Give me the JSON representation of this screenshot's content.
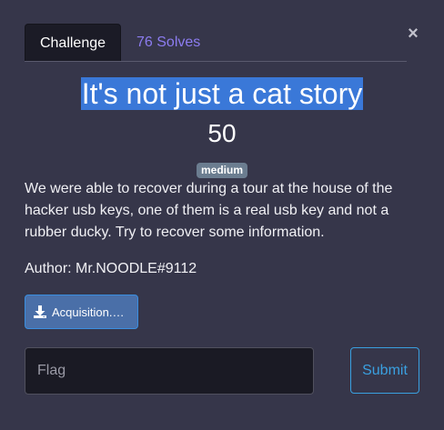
{
  "tabs": {
    "challenge": "Challenge",
    "solves": "76 Solves"
  },
  "close_symbol": "×",
  "challenge": {
    "name": "It's not just a cat story",
    "points": "50",
    "difficulty": "medium",
    "description": "We were able to recover during a tour at the house of the hacker usb keys, one of them is a real usb key and not a rubber ducky. Try to recover some information.",
    "author": "Author: Mr.NOODLE#9112"
  },
  "download": {
    "icon": "download-icon",
    "label": "Acquisition.…"
  },
  "flag": {
    "placeholder": "Flag",
    "value": ""
  },
  "submit_label": "Submit",
  "colors": {
    "background": "#36364a",
    "title_highlight": "#3a78d8",
    "solves_link": "#8c7cf0",
    "submit": "#3aa0e0"
  }
}
